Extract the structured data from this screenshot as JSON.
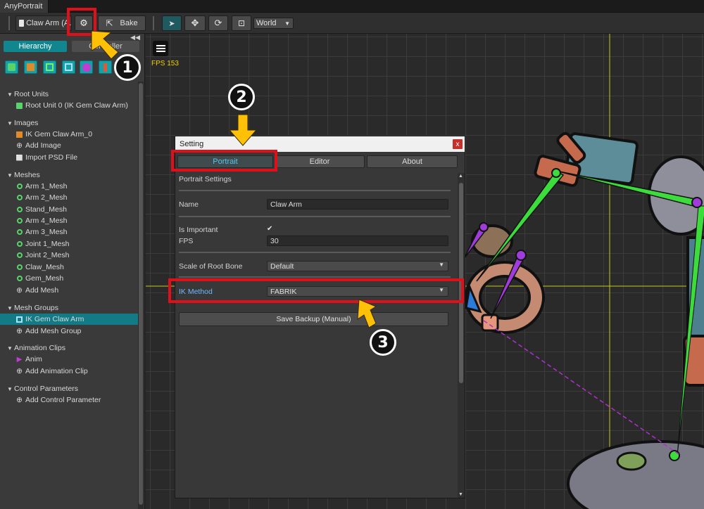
{
  "app": {
    "title": "AnyPortrait"
  },
  "toolbar": {
    "file_label": "Claw Arm (A.C",
    "bake_label": "Bake",
    "space_value": "World"
  },
  "left_panel": {
    "tabs": {
      "hierarchy": "Hierarchy",
      "controller": "Controller"
    },
    "tree": {
      "root_units": "Root Units",
      "root_unit_0": "Root Unit 0 (IK Gem Claw Arm)",
      "images": "Images",
      "image_0": "IK Gem Claw Arm_0",
      "add_image": "Add Image",
      "import_psd": "Import PSD File",
      "meshes": "Meshes",
      "mesh_items": [
        "Arm 1_Mesh",
        "Arm 2_Mesh",
        "Stand_Mesh",
        "Arm 4_Mesh",
        "Arm 3_Mesh",
        "Joint 1_Mesh",
        "Joint 2_Mesh",
        "Claw_Mesh",
        "Gem_Mesh"
      ],
      "add_mesh": "Add Mesh",
      "mesh_groups": "Mesh Groups",
      "mesh_group_0": "IK Gem Claw Arm",
      "add_mesh_group": "Add Mesh Group",
      "animation_clips": "Animation Clips",
      "anim": "Anim",
      "add_animation_clip": "Add Animation Clip",
      "control_parameters": "Control Parameters",
      "add_control_parameter": "Add Control Parameter"
    }
  },
  "viewport": {
    "fps": "FPS 153"
  },
  "dialog": {
    "title": "Setting",
    "close": "x",
    "tabs": {
      "portrait": "Portrait",
      "editor": "Editor",
      "about": "About"
    },
    "section_title": "Portrait Settings",
    "name_label": "Name",
    "name_value": "Claw Arm",
    "is_important_label": "Is Important",
    "is_important_checked": true,
    "fps_label": "FPS",
    "fps_value": "30",
    "scale_label": "Scale of Root Bone",
    "scale_value": "Default",
    "ik_label": "IK Method",
    "ik_value": "FABRIK",
    "backup_label": "Save Backup (Manual)"
  },
  "annotations": {
    "step1": "1",
    "step2": "2",
    "step3": "3"
  },
  "colors": {
    "accent": "#16a0a8",
    "highlight": "#e0101a",
    "arrow": "#ffc107",
    "bone_green": "#3ddc3d",
    "bone_purple": "#a13cdc"
  }
}
